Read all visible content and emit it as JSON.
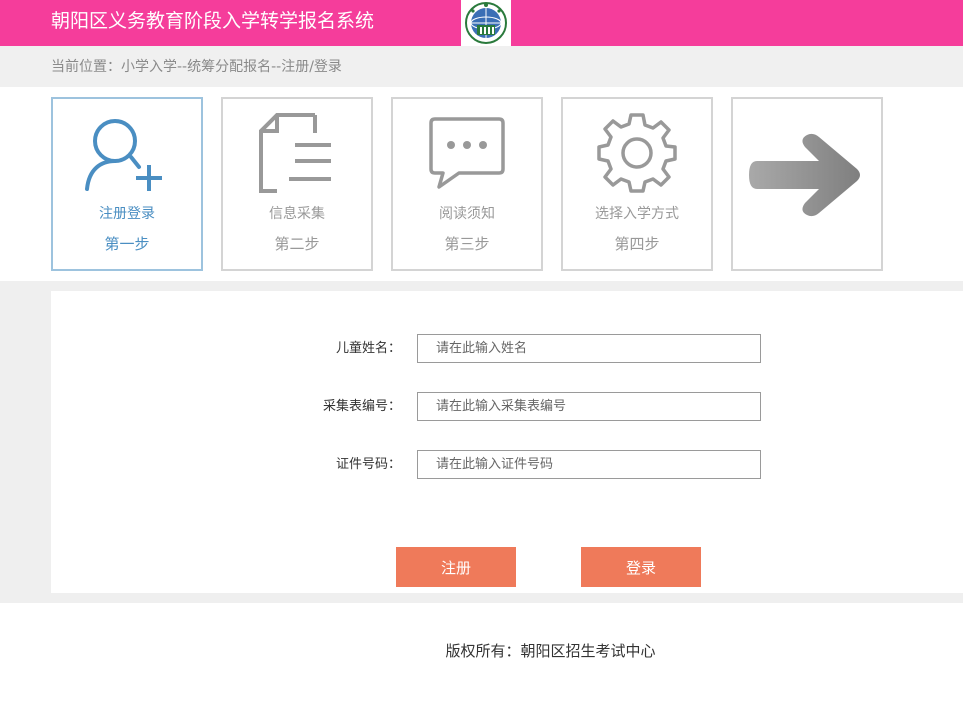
{
  "header": {
    "title": "朝阳区义务教育阶段入学转学报名系统",
    "logo_icon": "globe-emblem-icon"
  },
  "breadcrumb": {
    "text": "当前位置：小学入学--统筹分配报名--注册/登录"
  },
  "steps": [
    {
      "label": "注册登录",
      "sub": "第一步",
      "icon": "user-add-icon",
      "active": true
    },
    {
      "label": "信息采集",
      "sub": "第二步",
      "icon": "document-icon",
      "active": false
    },
    {
      "label": "阅读须知",
      "sub": "第三步",
      "icon": "chat-bubble-icon",
      "active": false
    },
    {
      "label": "选择入学方式",
      "sub": "第四步",
      "icon": "gear-icon",
      "active": false
    },
    {
      "label": "",
      "sub": "",
      "icon": "arrow-right-icon",
      "active": false
    }
  ],
  "form": {
    "fields": [
      {
        "label": "儿童姓名：",
        "placeholder": "请在此输入姓名",
        "value": ""
      },
      {
        "label": "采集表编号：",
        "placeholder": "请在此输入采集表编号",
        "value": ""
      },
      {
        "label": "证件号码：",
        "placeholder": "请在此输入证件号码",
        "value": ""
      }
    ],
    "register_label": "注册",
    "login_label": "登录"
  },
  "footer": {
    "text": "版权所有：朝阳区招生考试中心"
  },
  "colors": {
    "header_bg": "#f53d9b",
    "active_step": "#4a8ec2",
    "button_bg": "#ef7a5a"
  }
}
